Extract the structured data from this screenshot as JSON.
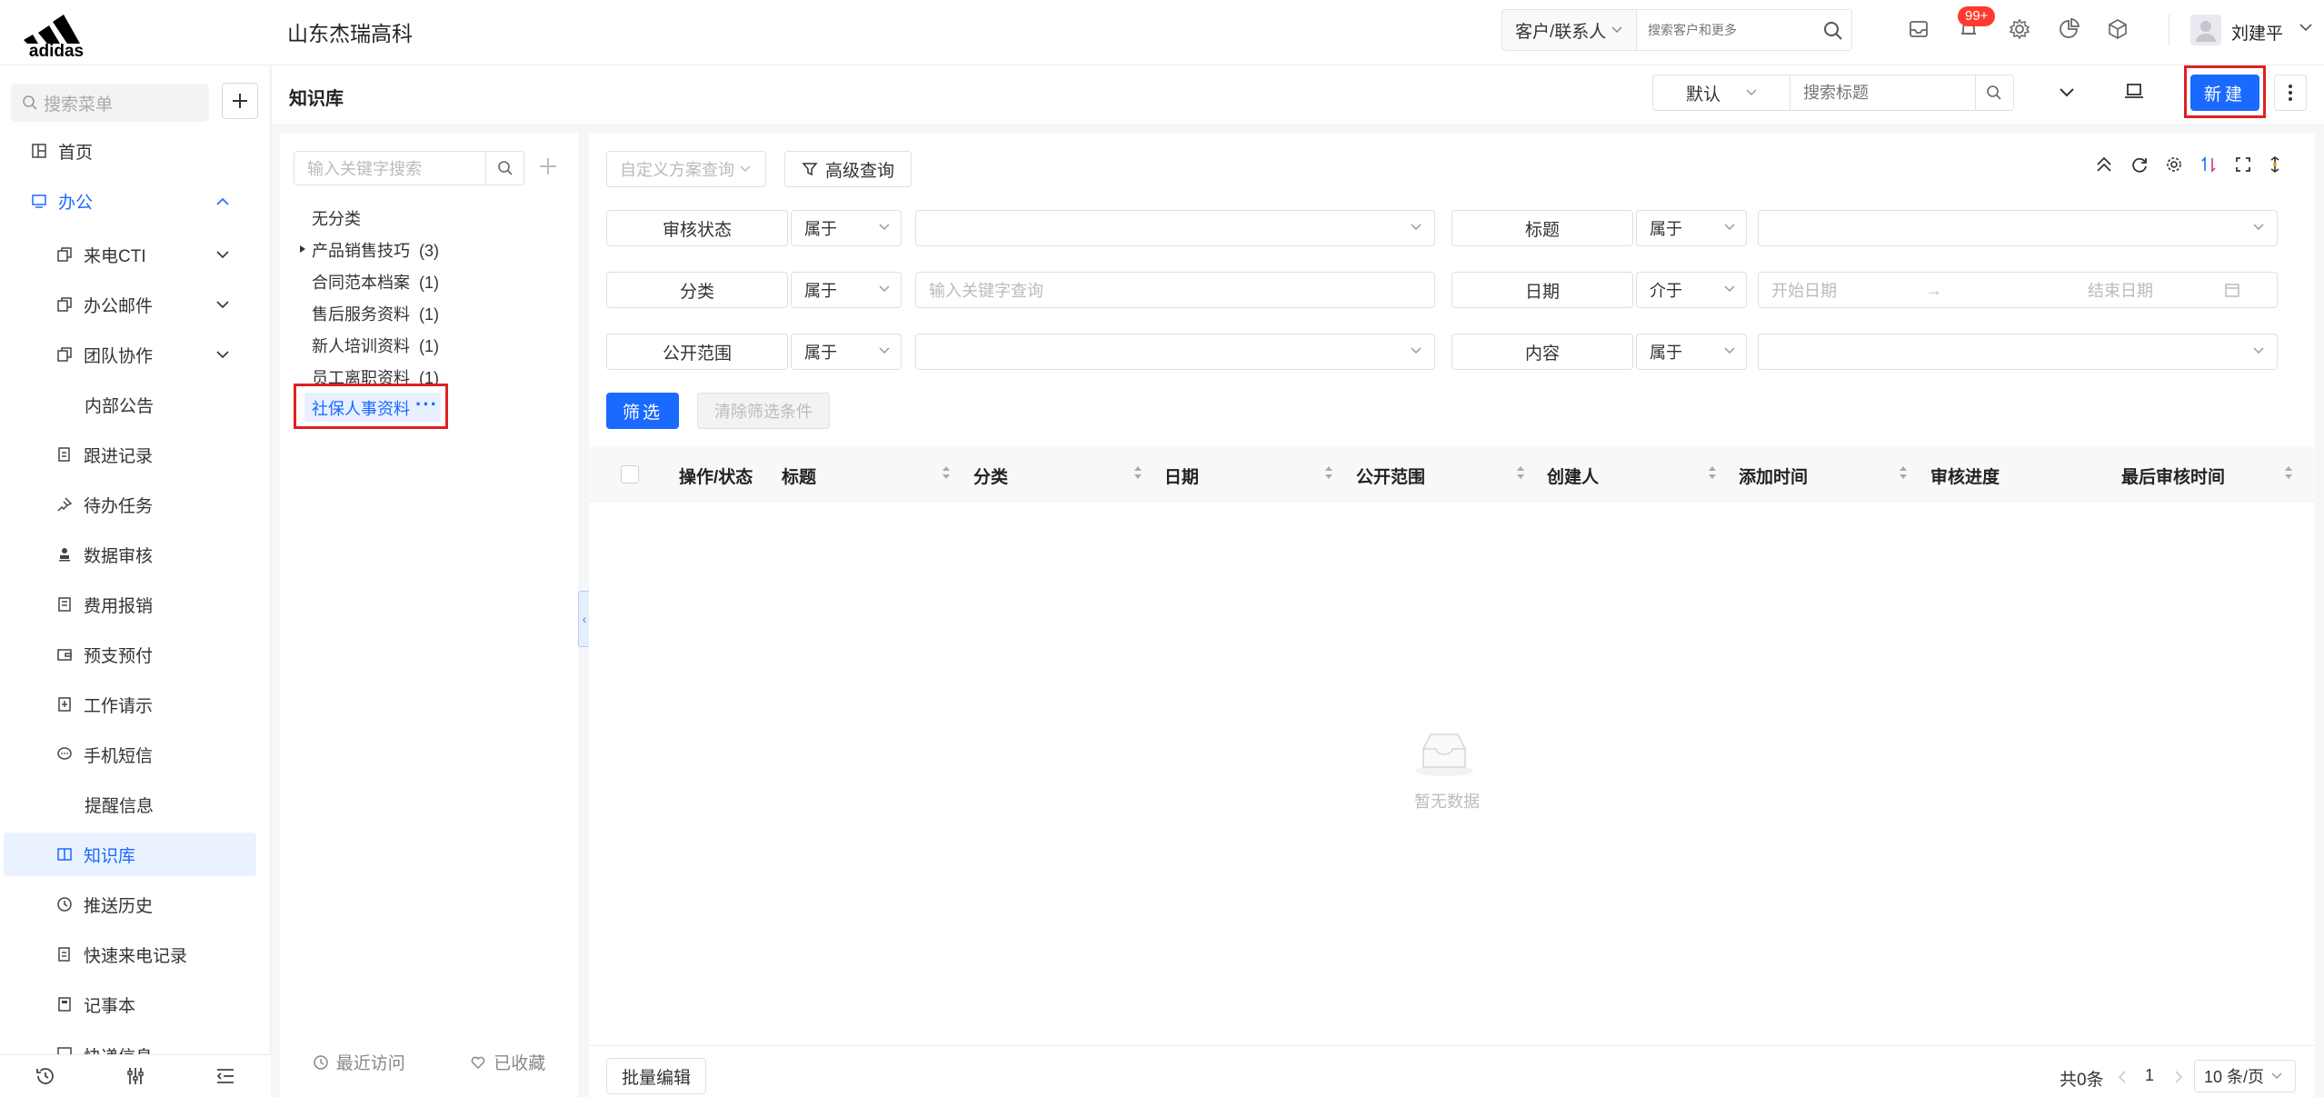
{
  "topbar": {
    "company": "山东杰瑞高科",
    "customer_select": "客户/联系人",
    "search_placeholder": "搜索客户和更多",
    "badge": "99+",
    "username": "刘建平"
  },
  "sidebar": {
    "search_placeholder": "搜索菜单",
    "items": [
      {
        "label": "首页",
        "icon": "layout-icon"
      },
      {
        "label": "办公",
        "icon": "monitor-icon"
      },
      {
        "label": "来电CTI",
        "icon": "copy-icon"
      },
      {
        "label": "办公邮件",
        "icon": "copy-icon"
      },
      {
        "label": "团队协作",
        "icon": "copy-icon"
      },
      {
        "label": "内部公告"
      },
      {
        "label": "跟进记录",
        "icon": "edit-icon"
      },
      {
        "label": "待办任务",
        "icon": "pin-icon"
      },
      {
        "label": "数据审核",
        "icon": "stamp-icon"
      },
      {
        "label": "费用报销",
        "icon": "receipt-icon"
      },
      {
        "label": "预支预付",
        "icon": "wallet-icon"
      },
      {
        "label": "工作请示",
        "icon": "document-icon"
      },
      {
        "label": "手机短信",
        "icon": "message-icon"
      },
      {
        "label": "提醒信息"
      },
      {
        "label": "知识库",
        "icon": "book-icon"
      },
      {
        "label": "推送历史",
        "icon": "clock-icon"
      },
      {
        "label": "快速来电记录",
        "icon": "edit-icon"
      },
      {
        "label": "记事本",
        "icon": "notebook-icon"
      },
      {
        "label": "快递信息",
        "icon": "box-icon"
      }
    ]
  },
  "header": {
    "title": "知识库",
    "view_select": "默认",
    "title_search_placeholder": "搜索标题",
    "new_label": "新建"
  },
  "tree": {
    "search_placeholder": "输入关键字搜索",
    "nodes": [
      {
        "label": "无分类",
        "count": ""
      },
      {
        "label": "产品销售技巧",
        "count": "(3)"
      },
      {
        "label": "合同范本档案",
        "count": "(1)"
      },
      {
        "label": "售后服务资料",
        "count": "(1)"
      },
      {
        "label": "新人培训资料",
        "count": "(1)"
      },
      {
        "label": "员工离职资料",
        "count": "(1)"
      }
    ],
    "selected": "社保人事资料",
    "recent": "最近访问",
    "favorites": "已收藏"
  },
  "filters": {
    "scheme_placeholder": "自定义方案查询",
    "advanced": "高级查询",
    "rows": [
      {
        "label": "审核状态",
        "op": "属于",
        "value": ""
      },
      {
        "label": "标题",
        "op": "属于",
        "value": ""
      },
      {
        "label": "分类",
        "op": "属于",
        "value": "输入关键字查询"
      },
      {
        "label": "日期",
        "op": "介于",
        "start": "开始日期",
        "end": "结束日期"
      },
      {
        "label": "公开范围",
        "op": "属于",
        "value": ""
      },
      {
        "label": "内容",
        "op": "属于",
        "value": ""
      }
    ],
    "filter_btn": "筛选",
    "clear_btn": "清除筛选条件"
  },
  "table": {
    "columns": [
      "操作/状态",
      "标题",
      "分类",
      "日期",
      "公开范围",
      "创建人",
      "添加时间",
      "审核进度",
      "最后审核时间"
    ],
    "empty": "暂无数据"
  },
  "footer": {
    "batch": "批量编辑",
    "total": "共0条",
    "page": "1",
    "page_size": "10 条/页"
  },
  "colors": {
    "accent": "#1a6aff",
    "highlight": "#e02020",
    "badge": "#ff3b30"
  }
}
